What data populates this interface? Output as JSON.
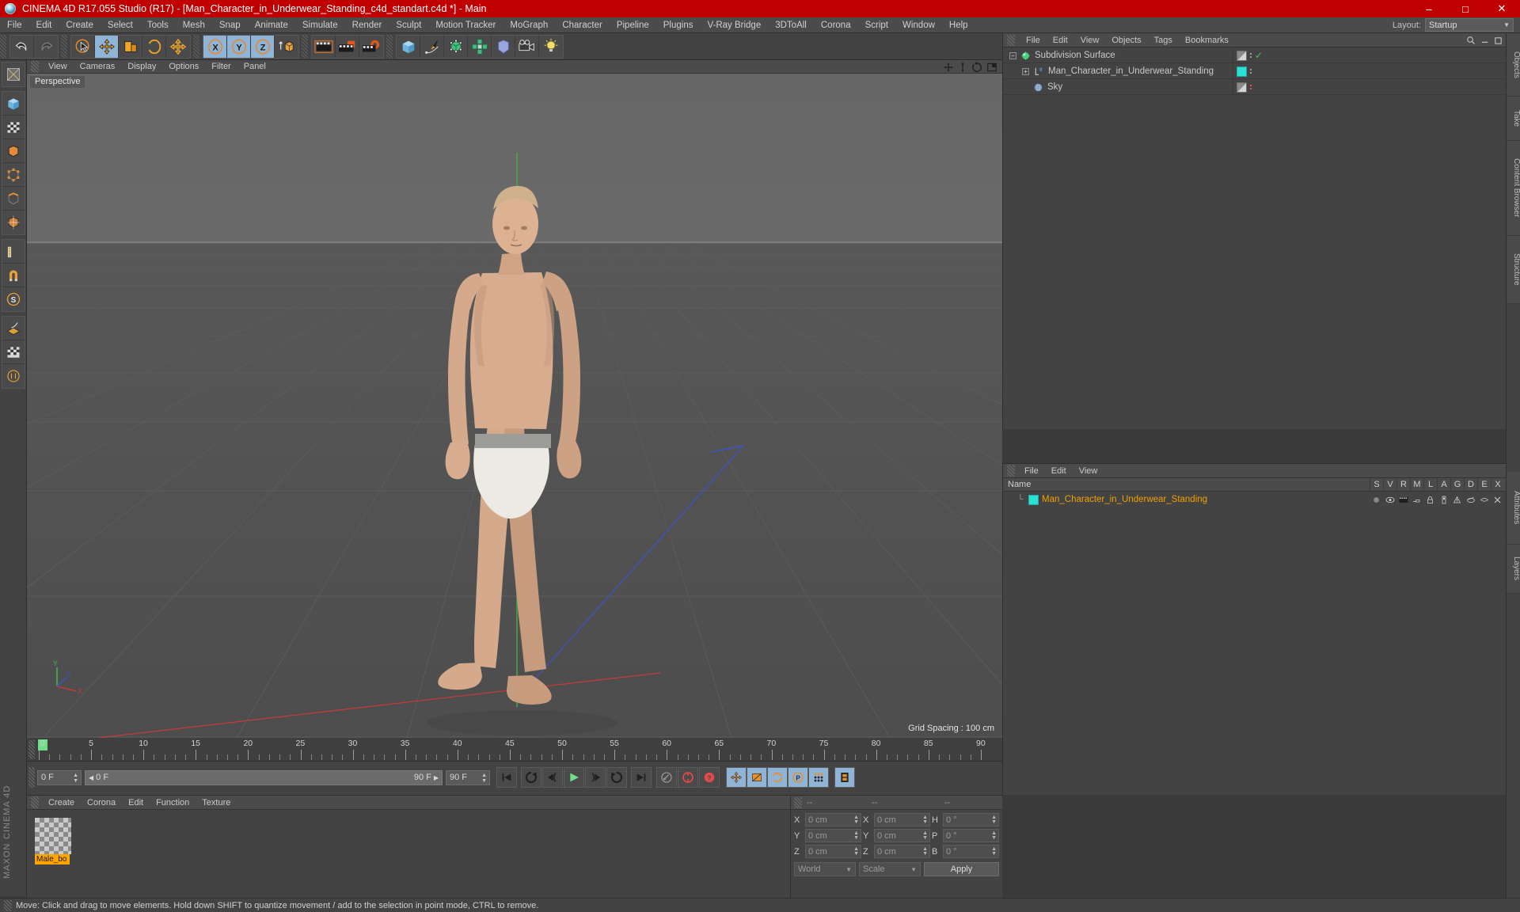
{
  "window": {
    "title": "CINEMA 4D R17.055 Studio (R17) - [Man_Character_in_Underwear_Standing_c4d_standart.c4d *] - Main",
    "minimize": "–",
    "maximize": "□",
    "close": "✕"
  },
  "menubar": {
    "items": [
      "File",
      "Edit",
      "Create",
      "Select",
      "Tools",
      "Mesh",
      "Snap",
      "Animate",
      "Simulate",
      "Render",
      "Sculpt",
      "Motion Tracker",
      "MoGraph",
      "Character",
      "Pipeline",
      "Plugins",
      "V-Ray Bridge",
      "3DToAll",
      "Corona",
      "Script",
      "Window",
      "Help"
    ],
    "layout_label": "Layout:",
    "layout_value": "Startup"
  },
  "toolbar": {
    "groups": [
      {
        "name": "undo-redo",
        "buttons": [
          {
            "icon": "undo-icon",
            "label": "Undo",
            "active": false
          },
          {
            "icon": "redo-icon",
            "label": "Redo",
            "active": false
          }
        ]
      },
      {
        "name": "transform-tools",
        "buttons": [
          {
            "icon": "select-cursor-icon",
            "label": "Live Selection",
            "active": false
          },
          {
            "icon": "move-icon",
            "label": "Move",
            "active": true
          },
          {
            "icon": "scale-icon",
            "label": "Scale",
            "active": false
          },
          {
            "icon": "rotate-icon",
            "label": "Rotate",
            "active": false
          },
          {
            "icon": "move-axis-icon",
            "label": "Move Axis",
            "active": false
          }
        ]
      },
      {
        "name": "axis-locks",
        "buttons": [
          {
            "icon": "x-axis-icon",
            "label": "X Axis",
            "active": true
          },
          {
            "icon": "y-axis-icon",
            "label": "Y Axis",
            "active": true
          },
          {
            "icon": "z-axis-icon",
            "label": "Z Axis",
            "active": true
          },
          {
            "icon": "world-object-coord-icon",
            "label": "World/Object Coordinate System",
            "active": false
          }
        ]
      },
      {
        "name": "render-tools",
        "buttons": [
          {
            "icon": "render-view-icon",
            "label": "Render View",
            "active": false
          },
          {
            "icon": "render-to-picture-viewer-icon",
            "label": "Render to Picture Viewer",
            "active": false
          },
          {
            "icon": "render-settings-icon",
            "label": "Edit Render Settings",
            "active": false
          }
        ]
      },
      {
        "name": "create-objects",
        "buttons": [
          {
            "icon": "cube-primitive-icon",
            "label": "Add Cube Object",
            "active": false
          },
          {
            "icon": "spline-pen-icon",
            "label": "Add Spline",
            "active": false
          },
          {
            "icon": "generator-icon",
            "label": "Add Generator",
            "active": false
          },
          {
            "icon": "deformer-icon",
            "label": "Add Deformer",
            "active": false
          },
          {
            "icon": "scene-object-icon",
            "label": "Add Scene Object",
            "active": false
          },
          {
            "icon": "camera-icon",
            "label": "Add Camera",
            "active": false
          },
          {
            "icon": "light-icon",
            "label": "Add Light",
            "active": false
          }
        ]
      }
    ]
  },
  "left_palette": {
    "groups": [
      {
        "buttons": [
          {
            "icon": "texture-axis-icon",
            "label": "Texture Axis"
          }
        ]
      },
      {
        "buttons": [
          {
            "icon": "model-mode-icon",
            "label": "Model Mode"
          },
          {
            "icon": "texture-mode-icon",
            "label": "Texture Mode"
          },
          {
            "icon": "polygon-mode-icon",
            "label": "Polygon Mode"
          },
          {
            "icon": "point-mode-icon",
            "label": "Point Mode"
          },
          {
            "icon": "edge-mode-icon",
            "label": "Edge Mode"
          },
          {
            "icon": "object-axis-icon",
            "label": "Object Axis Mode"
          }
        ]
      },
      {
        "buttons": [
          {
            "icon": "ruler-icon",
            "label": "Measure"
          },
          {
            "icon": "magnet-icon",
            "label": "Magnet"
          },
          {
            "icon": "snap-icon",
            "label": "Enable Snapping"
          }
        ]
      },
      {
        "buttons": [
          {
            "icon": "workplane-icon",
            "label": "Workplane"
          },
          {
            "icon": "lock-workplane-icon",
            "label": "Lock Workplane"
          },
          {
            "icon": "planar-workplane-icon",
            "label": "Planar Workplane"
          }
        ]
      }
    ],
    "brand_line1": "MAXON",
    "brand_line2": "CINEMA 4D"
  },
  "viewport": {
    "menu": [
      "View",
      "Cameras",
      "Display",
      "Options",
      "Filter",
      "Panel"
    ],
    "camera_label": "Perspective",
    "grid_spacing": "Grid Spacing : 100 cm",
    "axis_labels": {
      "y": "Y",
      "x": "X",
      "z": "Z"
    },
    "nav_icons": [
      "move-view-icon",
      "zoom-view-icon",
      "rotate-view-icon",
      "toggle-layout-icon"
    ]
  },
  "object_manager": {
    "menu": [
      "File",
      "Edit",
      "View",
      "Objects",
      "Tags",
      "Bookmarks"
    ],
    "search_icon": "search-icon",
    "rows": [
      {
        "name": "Subdivision Surface",
        "icon": "subdivision-surface-icon",
        "depth": 0,
        "expander": "-",
        "enabled_check": "✓",
        "tag_color": ""
      },
      {
        "name": "Man_Character_in_Underwear_Standing",
        "icon": "polygon-object-icon",
        "depth": 1,
        "expander": "+",
        "enabled_check": "",
        "tag_color": "#2ce0d4"
      },
      {
        "name": "Sky",
        "icon": "sky-object-icon",
        "depth": 1,
        "expander": "",
        "enabled_check": "",
        "tag_color": ""
      }
    ]
  },
  "attribute_manager": {
    "menu": [
      "File",
      "Edit",
      "View"
    ],
    "name_column": "Name",
    "columns": [
      "S",
      "V",
      "R",
      "M",
      "L",
      "A",
      "G",
      "D",
      "E",
      "X"
    ],
    "rows": [
      {
        "name": "Man_Character_in_Underwear_Standing",
        "swatch": "#2ce0d4"
      }
    ]
  },
  "right_dock_tabs": [
    "Objects",
    "Take",
    "Content Browser",
    "Structure",
    "Attributes",
    "Layers"
  ],
  "timeline": {
    "ruler_labels": [
      "0",
      "5",
      "10",
      "15",
      "20",
      "25",
      "30",
      "35",
      "40",
      "45",
      "50",
      "55",
      "60",
      "65",
      "70",
      "75",
      "80",
      "85",
      "90"
    ],
    "start_frame": "0 F",
    "current_frame_left": "0 F",
    "range_start": "0 F",
    "range_end": "90 F",
    "end_frame": "90 F",
    "frame_indicator": "0 F",
    "transport": [
      {
        "icon": "go-to-start-icon",
        "label": "Go to Start"
      },
      {
        "icon": "play-backwards-icon",
        "label": "Play Backwards"
      },
      {
        "icon": "previous-frame-icon",
        "label": "Go to Previous Frame"
      },
      {
        "icon": "play-forward-icon",
        "label": "Play Forward"
      },
      {
        "icon": "next-frame-icon",
        "label": "Go to Next Frame"
      },
      {
        "icon": "play-loop-icon",
        "label": "Play Mode Loop"
      },
      {
        "icon": "go-to-end-icon",
        "label": "Go to End"
      }
    ],
    "record_group": [
      {
        "icon": "autokeying-icon",
        "label": "Autokeying",
        "active": false
      },
      {
        "icon": "record-active-objects-icon",
        "label": "Record Active Objects",
        "active": false
      },
      {
        "icon": "keyframe-selection-icon",
        "label": "Keyframe Selection",
        "active": false
      }
    ],
    "param_group": [
      {
        "icon": "position-key-icon",
        "label": "Record Position",
        "active": true
      },
      {
        "icon": "scale-key-icon",
        "label": "Record Scale",
        "active": true
      },
      {
        "icon": "rotation-key-icon",
        "label": "Record Rotation",
        "active": true
      },
      {
        "icon": "pla-key-icon",
        "label": "Record PLA",
        "active": true
      },
      {
        "icon": "point-level-anim-icon",
        "label": "Record Parameter",
        "active": true
      }
    ],
    "timeline_button": {
      "icon": "timeline-icon",
      "label": "Timeline",
      "active": true
    }
  },
  "material_manager": {
    "menu": [
      "Create",
      "Corona",
      "Edit",
      "Function",
      "Texture"
    ],
    "materials": [
      {
        "name": "Male_bo",
        "full_name": "Male_body"
      }
    ]
  },
  "coordinates": {
    "header_cells": [
      "--",
      "--",
      "--"
    ],
    "rows": [
      {
        "pos_label": "X",
        "pos_value": "0 cm",
        "size_label": "X",
        "size_value": "0 cm",
        "rot_label": "H",
        "rot_value": "0 °"
      },
      {
        "pos_label": "Y",
        "pos_value": "0 cm",
        "size_label": "Y",
        "size_value": "0 cm",
        "rot_label": "P",
        "rot_value": "0 °"
      },
      {
        "pos_label": "Z",
        "pos_value": "0 cm",
        "size_label": "Z",
        "size_value": "0 cm",
        "rot_label": "B",
        "rot_value": "0 °"
      }
    ],
    "system": "World",
    "mode": "Scale",
    "apply": "Apply"
  },
  "statusbar": {
    "text": "Move: Click and drag to move elements. Hold down SHIFT to quantize movement / add to the selection in point mode, CTRL to remove."
  },
  "colors": {
    "title_bar": "#c00000",
    "panel_bg": "#434343",
    "menu_bg": "#4b4b4b",
    "active_blue": "#8fb4d6",
    "material_name_bg": "#ffa500",
    "tag_cyan": "#2ce0d4",
    "orange_text": "#f0a000"
  }
}
